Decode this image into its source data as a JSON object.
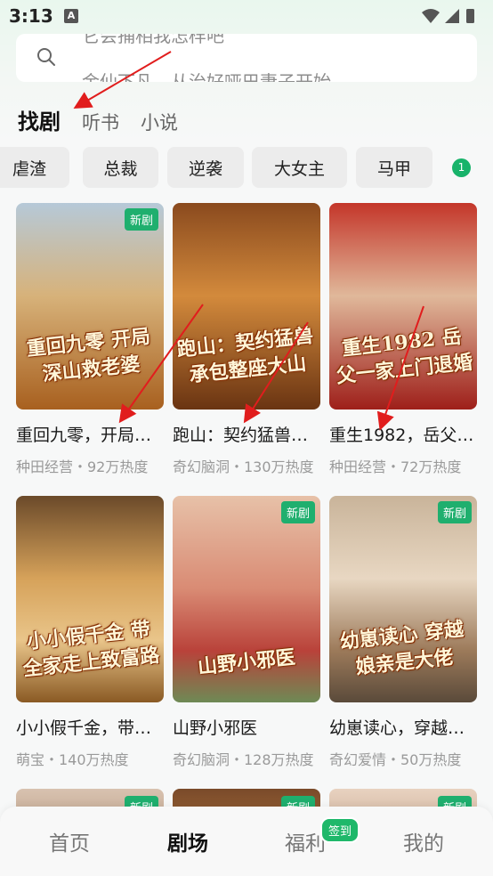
{
  "status_bar": {
    "time": "3:13",
    "indicator": "A"
  },
  "search": {
    "prev_hint": "它会捕相我怎样吧",
    "placeholder": "金仙下凡，从治好哑巴妻子开始"
  },
  "top_tabs": [
    {
      "label": "找剧",
      "active": true
    },
    {
      "label": "听书",
      "active": false
    },
    {
      "label": "小说",
      "active": false
    }
  ],
  "categories": [
    "虐渣",
    "总裁",
    "逆袭",
    "大女主",
    "马甲"
  ],
  "category_badge": "1",
  "new_badge": "新剧",
  "dramas": [
    {
      "title": "重回九零，开局深山救老婆",
      "poster_text": "重回九零 开局深山救老婆",
      "meta": "种田经营・92万热度",
      "is_new": true,
      "accent": "#c9892a"
    },
    {
      "title": "跑山：契约猛兽承包整座大山",
      "poster_text": "跑山：契约猛兽 承包整座大山",
      "meta": "奇幻脑洞・130万热度",
      "is_new": false,
      "accent": "#b5702c"
    },
    {
      "title": "重生1982，岳父一家上门退婚",
      "poster_text": "重生1982 岳父一家上门退婚",
      "meta": "种田经营・72万热度",
      "is_new": false,
      "accent": "#b53a2a"
    },
    {
      "title": "小小假千金，带全家走上致富路",
      "poster_text": "小小假千金 带全家走上致富路",
      "meta": "萌宝・140万热度",
      "is_new": false,
      "accent": "#d28d35"
    },
    {
      "title": "山野小邪医",
      "poster_text": "山野小邪医",
      "meta": "奇幻脑洞・128万热度",
      "is_new": true,
      "accent": "#d27b6a"
    },
    {
      "title": "幼崽读心，穿越娘亲是大佬",
      "poster_text": "幼崽读心 穿越娘亲是大佬",
      "meta": "奇幻爱情・50万热度",
      "is_new": true,
      "accent": "#a08a6a"
    }
  ],
  "bottom_nav": [
    {
      "label": "首页",
      "active": false
    },
    {
      "label": "剧场",
      "active": true
    },
    {
      "label": "福利",
      "active": false
    },
    {
      "label": "我的",
      "active": false
    }
  ],
  "nav_badge": "签到"
}
